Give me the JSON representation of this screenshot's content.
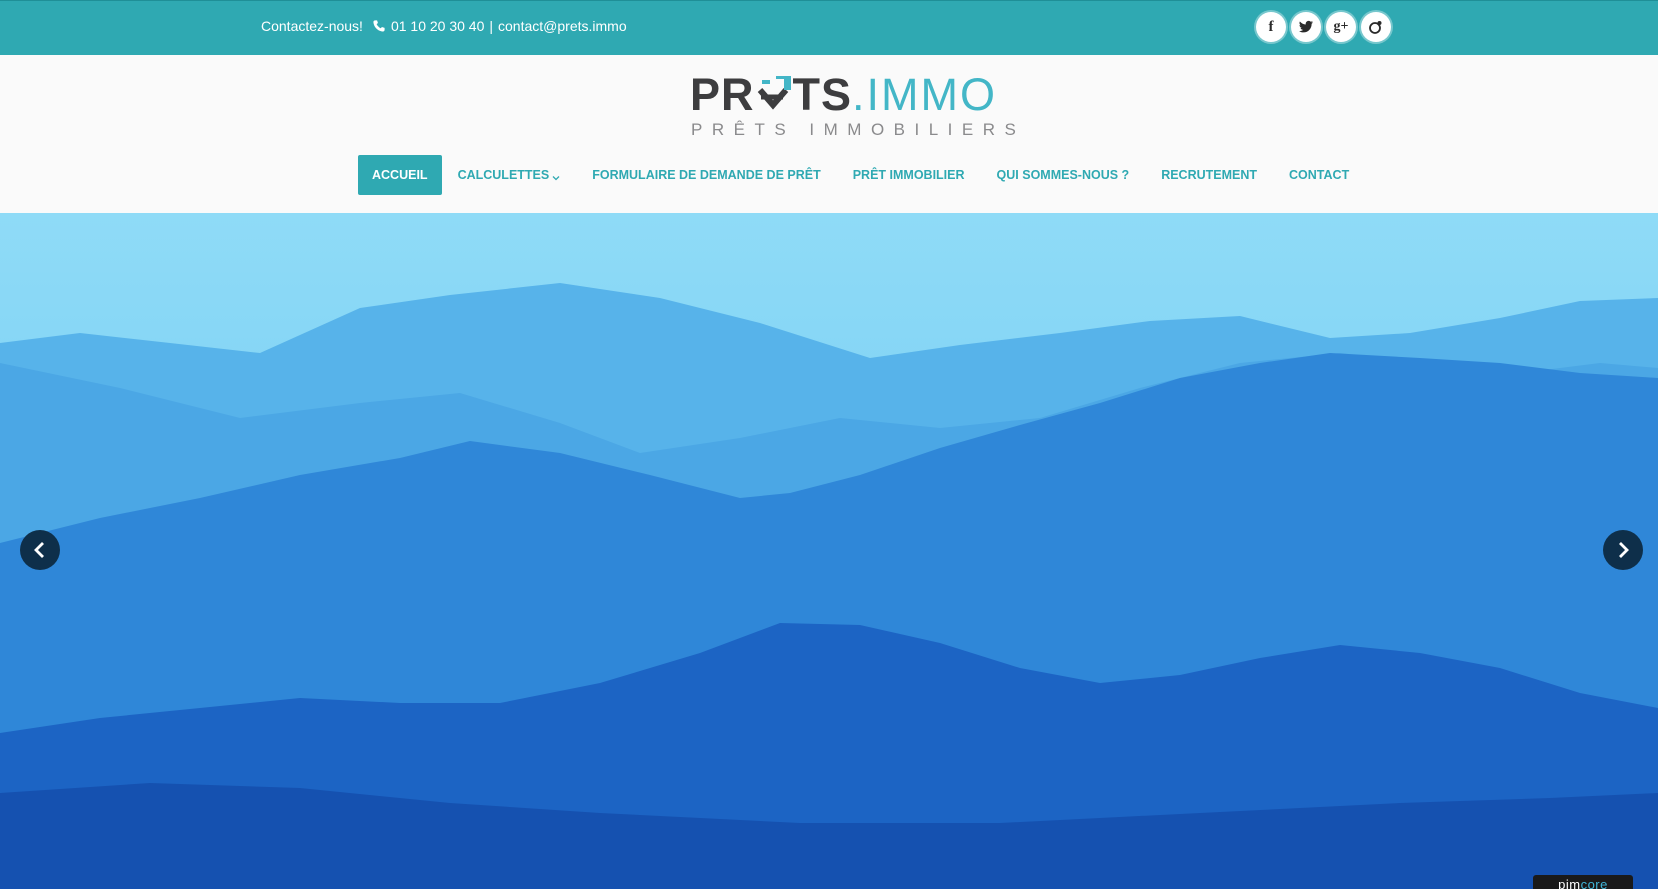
{
  "topbar": {
    "contact_lead": "Contactez-nous!",
    "phone": "01 10 20 30 40",
    "separator": "|",
    "email": "contact@prets.immo",
    "background": "#2fa9b2",
    "social": [
      {
        "name": "facebook-icon",
        "glyph": "f"
      },
      {
        "name": "twitter-icon",
        "glyph": ""
      },
      {
        "name": "google-plus-icon",
        "glyph": "g+"
      },
      {
        "name": "dribbble-icon",
        "glyph": ""
      }
    ]
  },
  "logo": {
    "brand_part1": "PR",
    "brand_part2": "TS",
    "brand_part3": ".IMMO",
    "tagline": "PRÊTS IMMOBILIERS",
    "dark_color": "#3d3d3f",
    "accent_color": "#43b6c7"
  },
  "nav": {
    "items": [
      {
        "label": "ACCUEIL",
        "active": true
      },
      {
        "label": "CALCULETTES",
        "has_dropdown": true
      },
      {
        "label": "FORMULAIRE DE DEMANDE DE PRÊT"
      },
      {
        "label": "PRÊT IMMOBILIER"
      },
      {
        "label": "QUI SOMMES-NOUS ?"
      },
      {
        "label": "RECRUTEMENT"
      },
      {
        "label": "CONTACT"
      }
    ],
    "accent": "#2fa9b2"
  },
  "hero": {
    "description_icon_prev": "chevron-left-icon",
    "description_icon_next": "chevron-right-icon"
  },
  "badge": {
    "text_part1": "pim",
    "text_part2": "core"
  }
}
